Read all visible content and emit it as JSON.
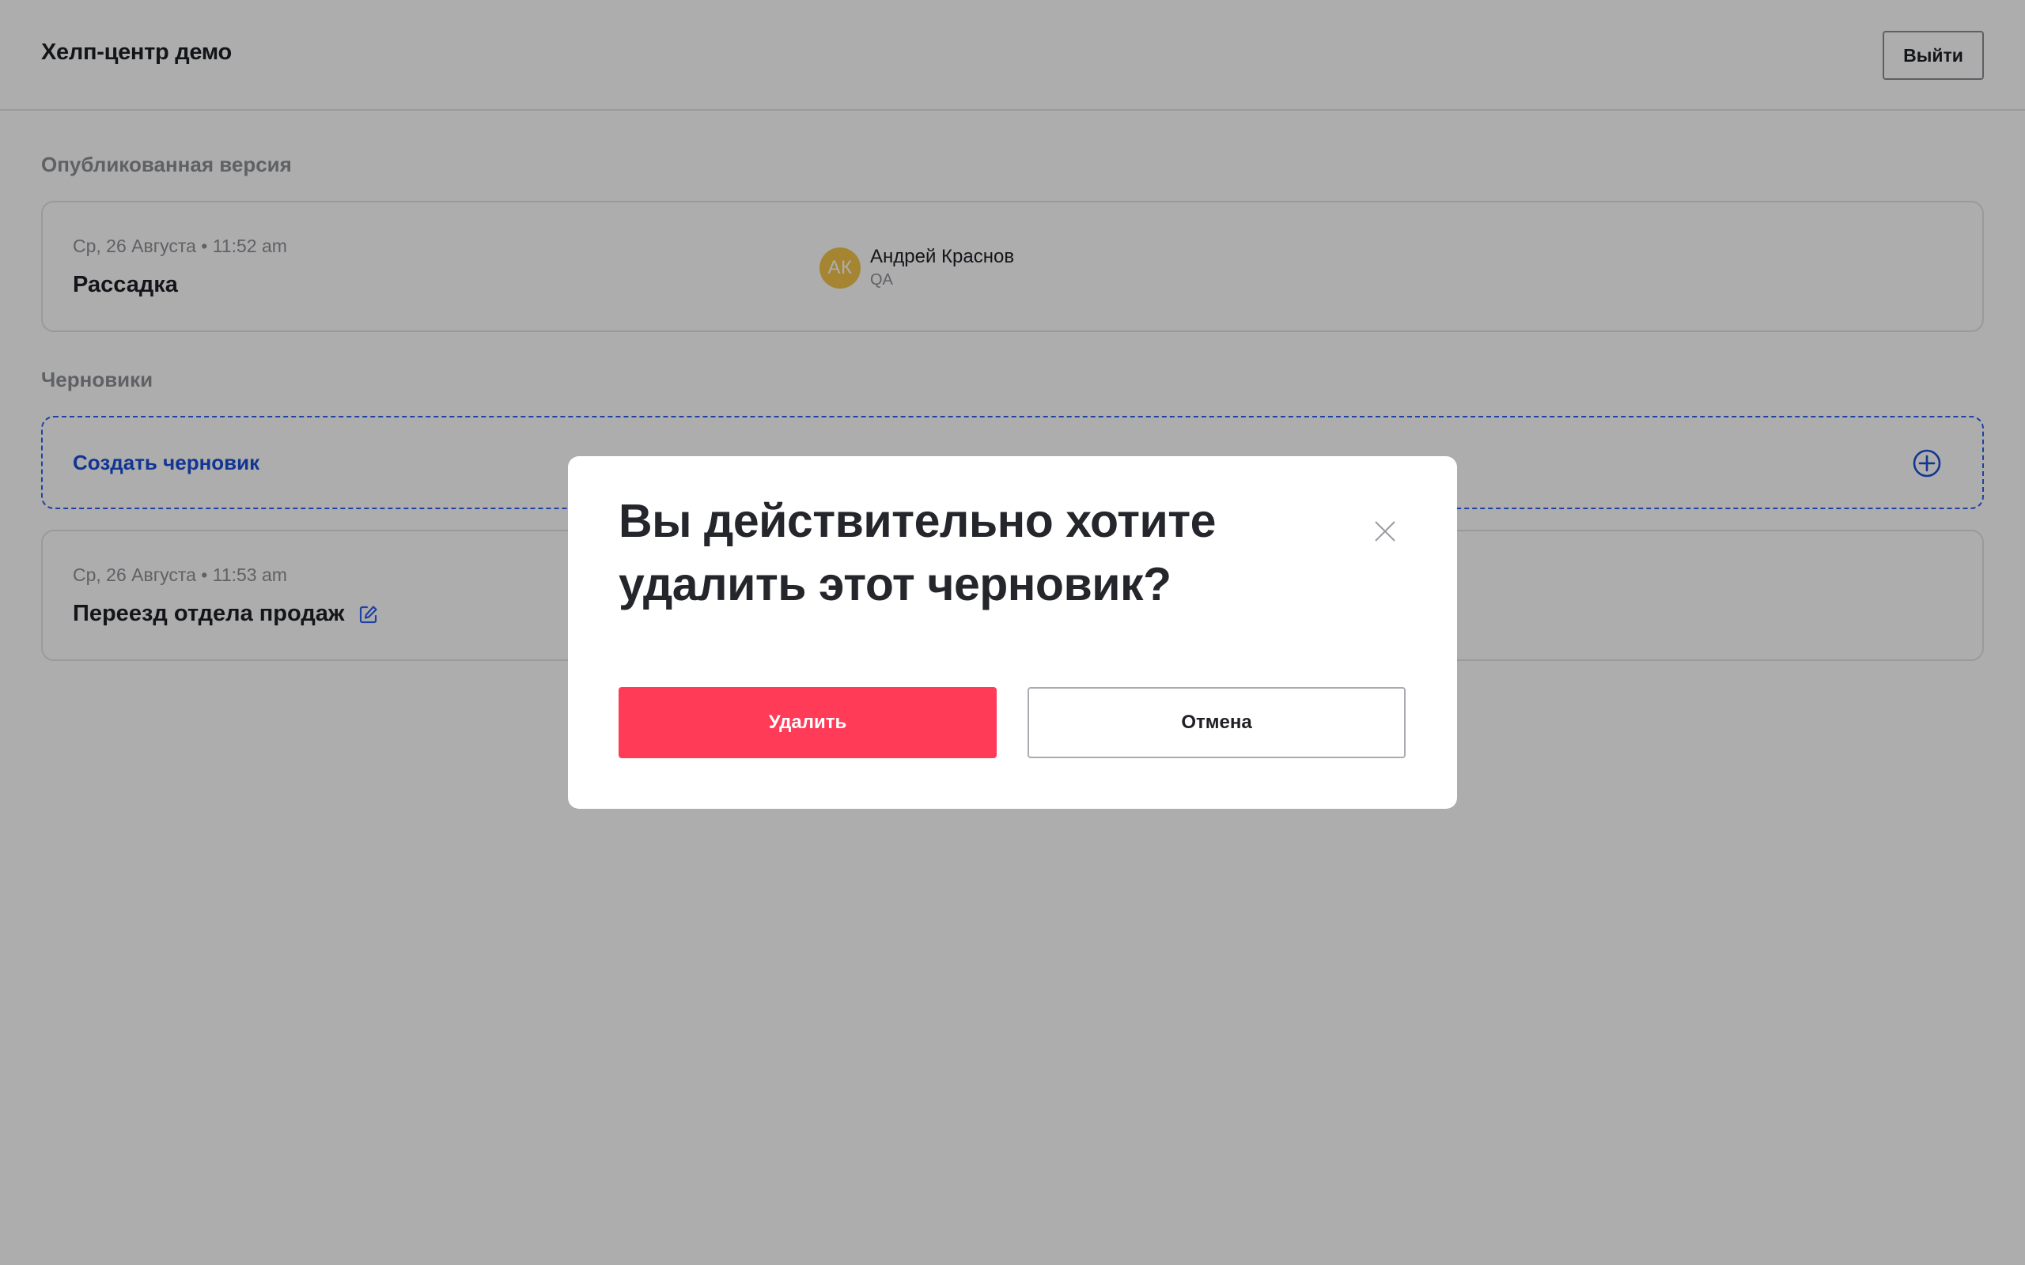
{
  "header": {
    "app_title": "Хелп-центр демо",
    "logout_label": "Выйти"
  },
  "published": {
    "section_label": "Опубликованная версия",
    "card": {
      "date": "Ср, 26 Августа • 11:52 am",
      "title": "Рассадка",
      "author": {
        "initials": "АК",
        "name": "Андрей Краснов",
        "role": "QA",
        "avatar_color": "#f3c44b"
      }
    }
  },
  "drafts": {
    "section_label": "Черновики",
    "create_label": "Создать черновик",
    "create_icon": "plus-circle-icon",
    "items": [
      {
        "date": "Ср, 26 Августа • 11:53 am",
        "title": "Переезд отдела продаж",
        "icon": "edit-icon"
      }
    ]
  },
  "modal": {
    "title": "Вы действительно хотите удалить этот черновик?",
    "delete_label": "Удалить",
    "cancel_label": "Отмена",
    "close_icon": "close-icon"
  },
  "colors": {
    "accent": "#1c4fd7",
    "danger": "#ff3b58",
    "text": "#1e2026",
    "muted": "#8d8f96"
  }
}
